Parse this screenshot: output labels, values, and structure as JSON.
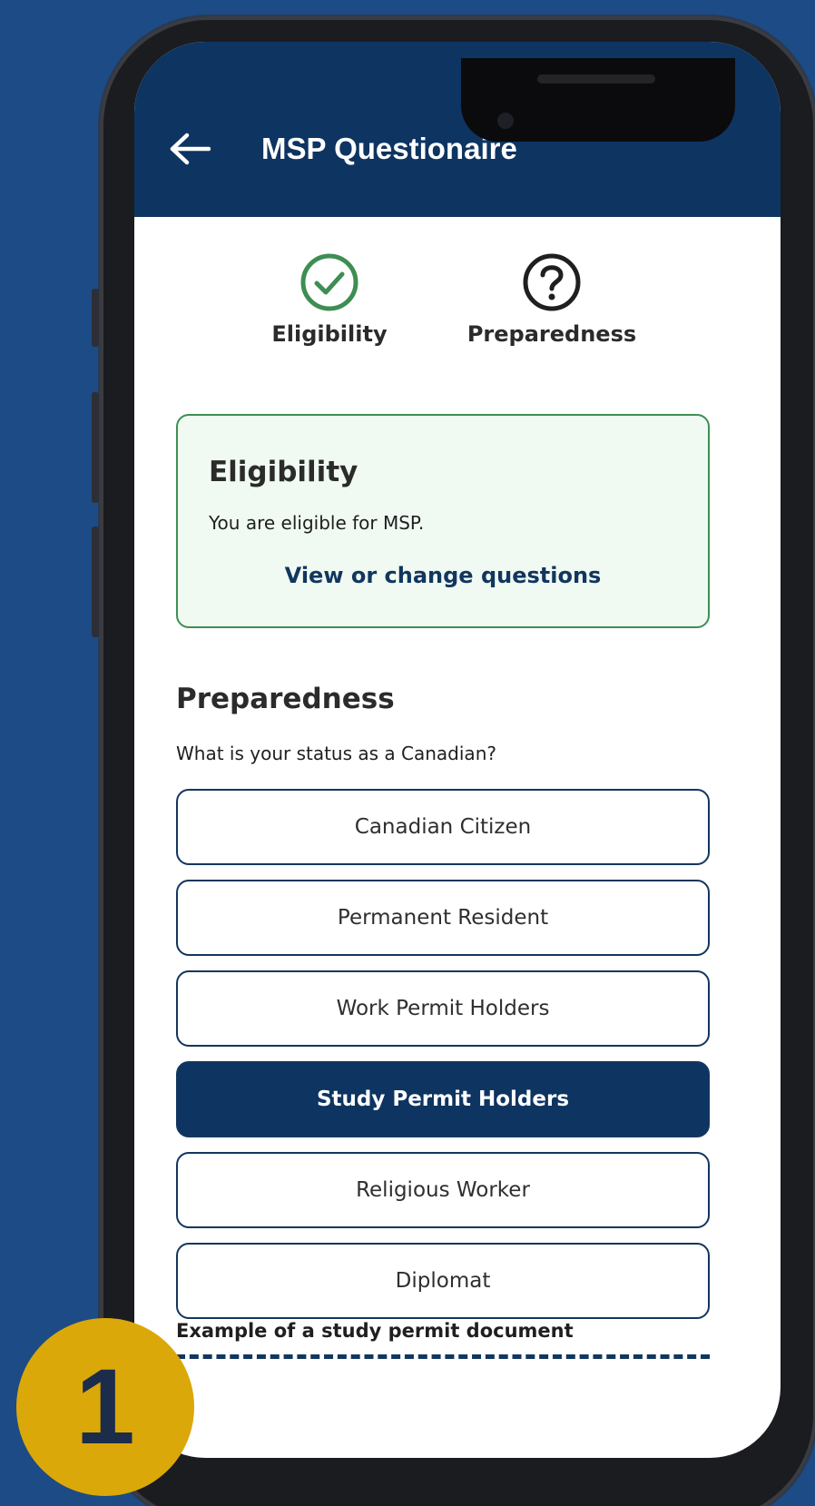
{
  "appbar": {
    "title": "MSP Questionaire",
    "back_icon": "arrow-left-icon",
    "background": "#0e3461"
  },
  "steps": [
    {
      "label": "Eligibility",
      "icon": "check-circle-icon",
      "state": "complete",
      "color": "#3e8e53"
    },
    {
      "label": "Preparedness",
      "icon": "question-circle-icon",
      "state": "current",
      "color": "#1f1f1f"
    }
  ],
  "eligibility": {
    "title": "Eligibility",
    "message": "You are eligible for MSP.",
    "link": "View or change questions"
  },
  "preparedness": {
    "heading": "Preparedness",
    "question": "What is your status as a Canadian?",
    "options": [
      {
        "label": "Canadian Citizen",
        "selected": false
      },
      {
        "label": "Permanent Resident",
        "selected": false
      },
      {
        "label": "Work Permit Holders",
        "selected": false
      },
      {
        "label": "Study Permit Holders",
        "selected": true
      },
      {
        "label": "Religious Worker",
        "selected": false
      },
      {
        "label": "Diplomat",
        "selected": false
      }
    ],
    "document_caption": "Example of a study permit document"
  },
  "badge": {
    "number": "1",
    "color": "#dba80a"
  },
  "colors": {
    "page_background": "#1d4b85",
    "accent": "#0e3461",
    "success": "#3e8e53"
  }
}
